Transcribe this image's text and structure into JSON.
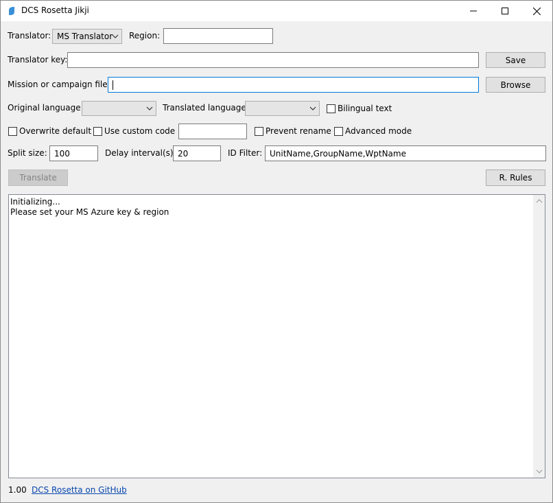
{
  "window": {
    "title": "DCS Rosetta Jikji"
  },
  "icons": {
    "app": "app-icon",
    "minimize": "minimize-icon",
    "maximize": "maximize-icon",
    "close": "close-icon"
  },
  "translator": {
    "label": "Translator:",
    "selected": "MS Translator"
  },
  "region": {
    "label": "Region:",
    "value": ""
  },
  "translator_key": {
    "label": "Translator key:",
    "value": "",
    "button": "Save"
  },
  "mission_file": {
    "label": "Mission or campaign file:",
    "value": "",
    "button": "Browse"
  },
  "original_language": {
    "label": "Original language:",
    "selected": ""
  },
  "translated_language": {
    "label": "Translated language:",
    "selected": ""
  },
  "options": {
    "bilingual": {
      "label": "Bilingual text",
      "checked": false
    },
    "overwrite_default": {
      "label": "Overwrite default",
      "checked": false
    },
    "use_custom_code": {
      "label": "Use custom code",
      "checked": false,
      "value": ""
    },
    "prevent_rename": {
      "label": "Prevent rename",
      "checked": false
    },
    "advanced_mode": {
      "label": "Advanced mode",
      "checked": false
    }
  },
  "split_size": {
    "label": "Split size:",
    "value": "100"
  },
  "delay_interval": {
    "label": "Delay interval(s):",
    "value": "20"
  },
  "id_filter": {
    "label": "ID Filter:",
    "value": "UnitName,GroupName,WptName"
  },
  "actions": {
    "translate": "Translate",
    "rules": "R. Rules"
  },
  "log": {
    "lines": "Initializing...\nPlease set your MS Azure key & region"
  },
  "footer": {
    "version": "1.00",
    "link": "DCS Rosetta on GitHub"
  },
  "colors": {
    "accent": "#0078d7",
    "link": "#0645ad",
    "background": "#f0f0f0"
  }
}
